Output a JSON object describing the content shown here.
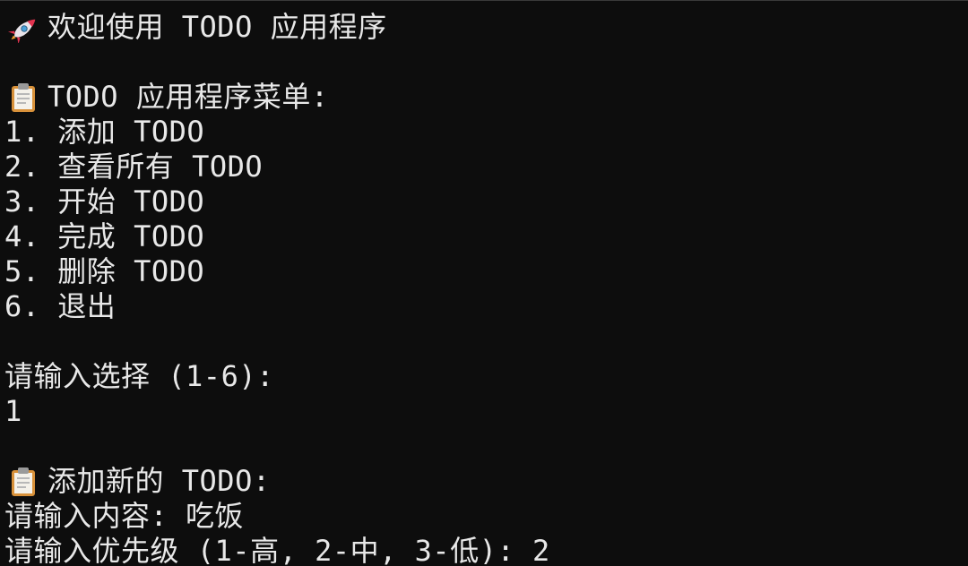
{
  "terminal": {
    "welcome": "欢迎使用 TODO 应用程序",
    "menu_title": "TODO 应用程序菜单:",
    "menu_items": [
      "1. 添加 TODO",
      "2. 查看所有 TODO",
      "3. 开始 TODO",
      "4. 完成 TODO",
      "5. 删除 TODO",
      "6. 退出"
    ],
    "choice_prompt": "请输入选择 (1-6):",
    "choice_value": "1",
    "add_title": "添加新的 TODO:",
    "content_prompt": "请输入内容: 吃饭",
    "priority_prompt": "请输入优先级 (1-高, 2-中, 3-低): 2"
  },
  "icons": {
    "welcome_icon": "rocket-icon",
    "menu_icon": "clipboard-icon",
    "add_icon": "clipboard-icon"
  },
  "colors": {
    "background": "#0d0d0d",
    "text": "#e8e8e8"
  }
}
